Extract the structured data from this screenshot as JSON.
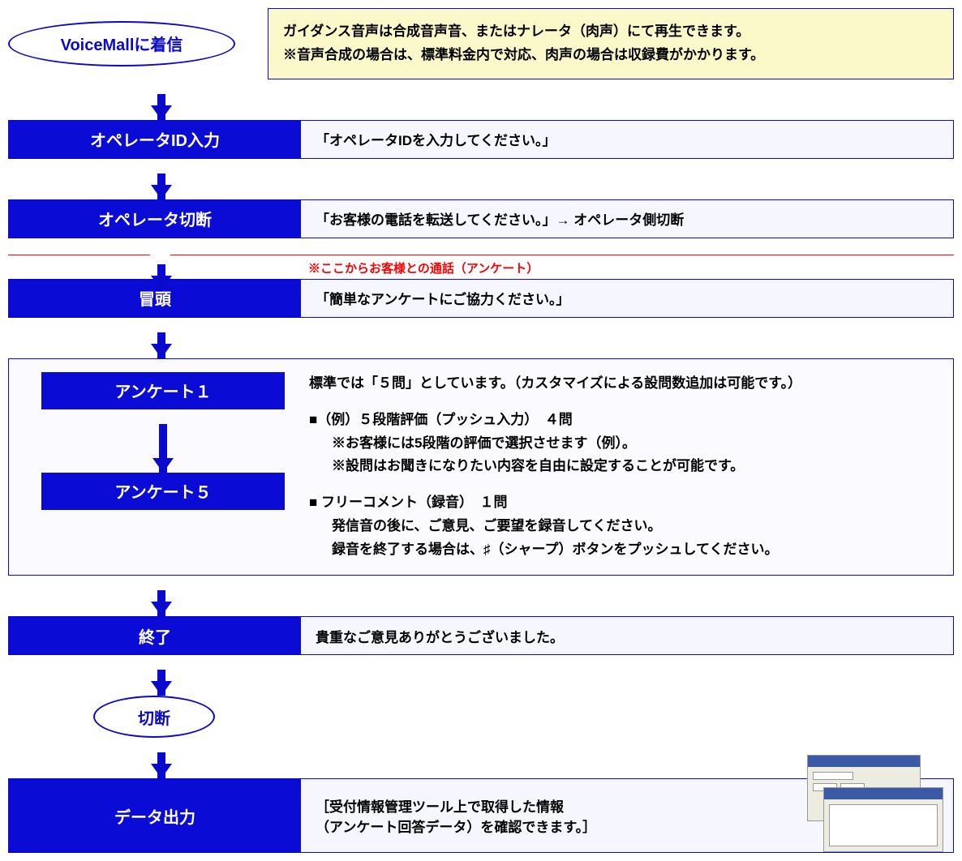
{
  "start_ellipse": "VoiceMallに着信",
  "note": {
    "line1": "ガイダンス音声は合成音声音、またはナレータ（肉声）にて再生できます。",
    "line2": "※音声合成の場合は、標準料金内で対応、肉声の場合は収録費がかかります。"
  },
  "steps": {
    "operator_id": {
      "label": "オペレータID入力",
      "desc": "「オペレータIDを入力してください。」"
    },
    "operator_disconnect": {
      "label": "オペレータ切断",
      "desc": "「お客様の電話を転送してください。」→ オペレータ側切断"
    },
    "intro": {
      "label": "冒頭",
      "desc": "「簡単なアンケートにご協力ください。」"
    },
    "end": {
      "label": "終了",
      "desc": "貴重なご意見ありがとうございました。"
    },
    "data_output": {
      "label": "データ出力",
      "desc1": "［受付情報管理ツール上で取得した情報",
      "desc2": "（アンケート回答データ）を確認できます。］"
    }
  },
  "divider_note": "※ここからお客様との通話（アンケート）",
  "survey": {
    "label1": "アンケート１",
    "label5": "アンケート５",
    "top": "標準では「５問」としています。（カスタマイズによる設問数追加は可能です。）",
    "block1_head": "■（例）５段階評価（プッシュ入力）　４問",
    "block1_l1": "※お客様には5段階の評価で選択させます（例）。",
    "block1_l2": "※設問はお聞きになりたい内容を自由に設定することが可能です。",
    "block2_head": "■ フリーコメント（録音）　１問",
    "block2_l1": "発信音の後に、ご意見、ご要望を録音してください。",
    "block2_l2": "録音を終了する場合は、♯（シャープ）ボタンをプッシュしてください。"
  },
  "disconnect_ellipse": "切断"
}
